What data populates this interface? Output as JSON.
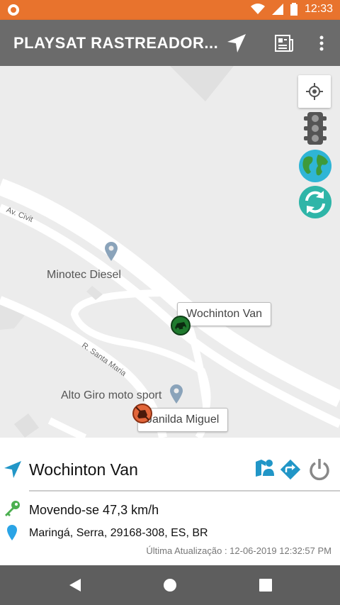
{
  "status_bar": {
    "time": "12:33"
  },
  "app_bar": {
    "title": "PLAYSAT RASTREADOR..."
  },
  "map": {
    "labels": {
      "street_civit": "Av. Civit",
      "street_santa_maria": "R. Santa Maria",
      "poi_minotec": "Minotec Diesel",
      "poi_altogiro": "Alto Giro moto sport"
    },
    "markers": [
      {
        "name": "Wochinton Van",
        "status": "moving",
        "color": "#1f7a2e"
      },
      {
        "name": "Janilda Miguel",
        "status": "stopped",
        "color": "#e2663a"
      }
    ]
  },
  "panel": {
    "vehicle_name": "Wochinton Van",
    "status": "Movendo-se 47,3 km/h",
    "address": "Maringá, Serra, 29168-308, ES, BR",
    "last_update": "Última Atualização : 12-06-2019 12:32:57 PM"
  },
  "colors": {
    "accent_blue": "#2196c7",
    "key_green": "#4caf50",
    "status_bar": "#e8732d",
    "app_bar": "#6b6b6b"
  }
}
